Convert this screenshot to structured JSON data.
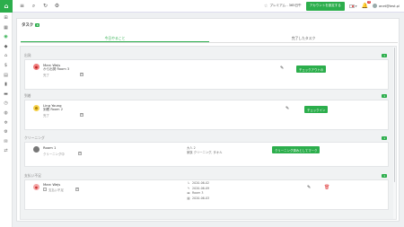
{
  "topbar": {
    "premium_label": "プレミアム - 365日午",
    "upgrade_label": "アカウントを設定する",
    "notif_count": "0",
    "user_email": "anet@test.pl"
  },
  "panel": {
    "title": "タスク",
    "title_count": "4",
    "tabs": [
      "今日やること",
      "完了したタスク"
    ]
  },
  "sections": [
    {
      "title": "出発",
      "count": "1",
      "guest": "Marc Wejs",
      "room": "から出発 Room 3",
      "status": "完了",
      "action": "チェックアウトの"
    },
    {
      "title": "到着",
      "count": "1",
      "guest": "Ling Young",
      "room": "到着 Room 2",
      "status": "完了",
      "action": "チェックイン"
    },
    {
      "title": "クリーニング",
      "count": "1",
      "room": "Room 1",
      "status": "クリーニング中",
      "info_a": "大人 2",
      "info_b": "家族  クリーニング, タオル",
      "action": "クリーニング済みとしてマーク"
    },
    {
      "title": "支払い不足",
      "count": "1",
      "guest": "Marc Wejs",
      "status": "支払い不足",
      "date_in": "2020-06-02",
      "date_out": "2020-06-09",
      "room": "Room 3",
      "date_due": "2020-06-03"
    }
  ]
}
